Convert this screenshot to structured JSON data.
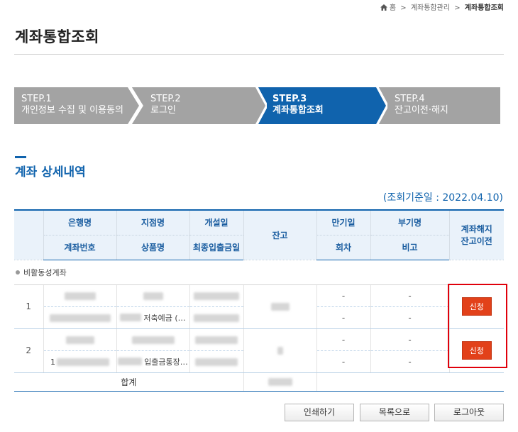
{
  "breadcrumb": {
    "home": "홈",
    "sep": ">",
    "item1": "계좌통합관리",
    "current": "계좌통합조회"
  },
  "page_title": "계좌통합조회",
  "steps": [
    {
      "num": "STEP.1",
      "label": "개인정보 수집 및 이용동의",
      "state": "inactive"
    },
    {
      "num": "STEP.2",
      "label": "로그인",
      "state": "inactive"
    },
    {
      "num": "STEP.3",
      "label": "계좌통합조회",
      "state": "active"
    },
    {
      "num": "STEP.4",
      "label": "잔고이전·해지",
      "state": "inactive"
    }
  ],
  "section_title": "계좌 상세내역",
  "query_date": "(조회기준일 : 2022.04.10)",
  "table": {
    "header": {
      "bank": "은행명",
      "branch": "지점명",
      "open_date": "개설일",
      "account_no": "계좌번호",
      "product": "상품명",
      "last_txn": "최종입출금일",
      "balance": "잔고",
      "maturity": "만기일",
      "sub_account": "부기명",
      "installment": "회차",
      "note": "비고",
      "close_l1": "계좌해지",
      "close_l2": "잔고이전"
    },
    "group_label": "비활동성계좌",
    "rows": [
      {
        "no": "1",
        "product": "저축예금 (…",
        "maturity": "-",
        "sub_account": "-",
        "installment": "-",
        "note": "-",
        "action": "신청"
      },
      {
        "no": "2",
        "account_prefix": "1",
        "product": "입출금통장…",
        "maturity": "-",
        "sub_account": "-",
        "installment": "-",
        "note": "-",
        "action": "신청"
      }
    ],
    "total_label": "합계"
  },
  "buttons": {
    "print": "인쇄하기",
    "list": "목록으로",
    "logout": "로그아웃"
  },
  "colors": {
    "accent": "#1063ad",
    "step_inactive": "#a3a3a3",
    "apply": "#e2411a",
    "highlight": "#e0000b"
  }
}
